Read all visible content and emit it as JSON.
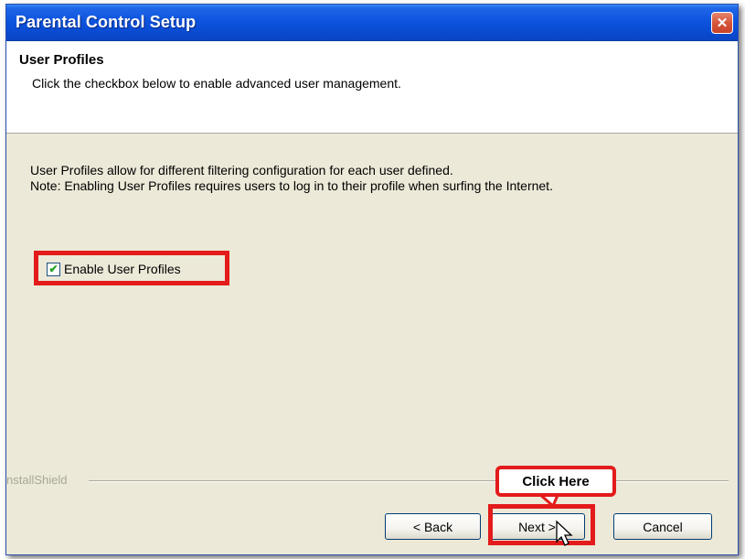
{
  "window": {
    "title": "Parental Control Setup",
    "close_icon": "close-icon"
  },
  "header": {
    "title": "User Profiles",
    "subtitle": "Click the checkbox below to enable advanced user management."
  },
  "body": {
    "description_line1": "User Profiles allow for different filtering configuration for each user defined.",
    "description_line2": "Note: Enabling User Profiles requires users to log in to their profile when surfing the Internet."
  },
  "checkbox": {
    "label": "Enable User Profiles",
    "checked": true,
    "check_glyph": "✔"
  },
  "footer": {
    "installshield_label": "nstallShield"
  },
  "buttons": {
    "back": "< Back",
    "next": "Next >",
    "cancel": "Cancel"
  },
  "annotation": {
    "callout_text": "Click Here",
    "highlight_color": "#e31b1b"
  }
}
